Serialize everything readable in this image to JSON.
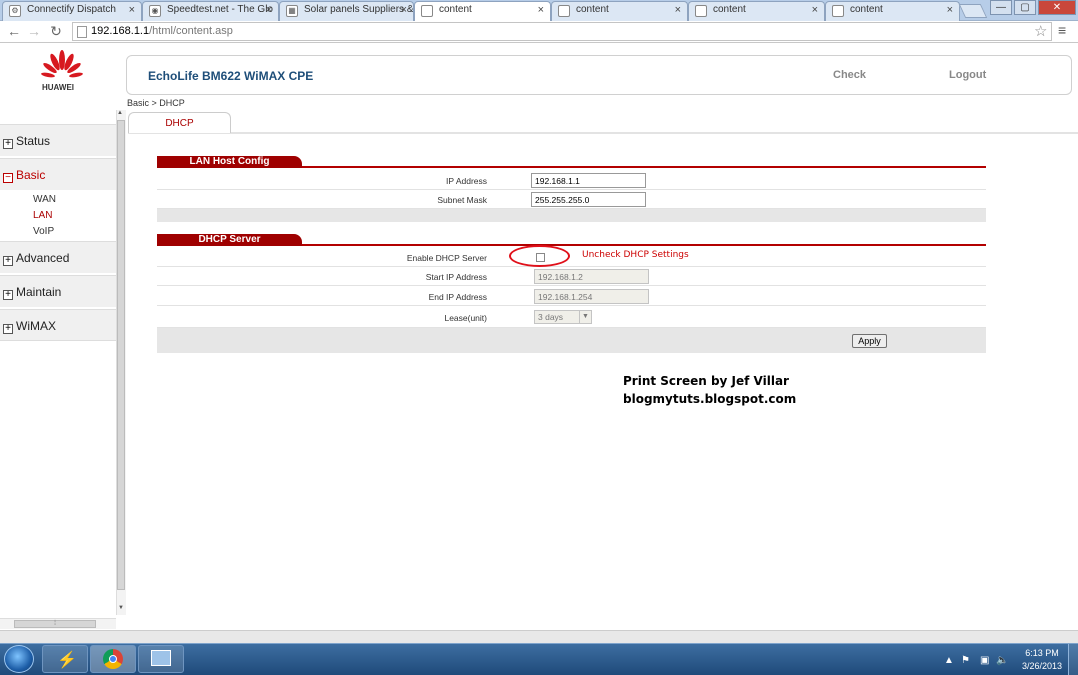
{
  "browser": {
    "tabs": [
      {
        "label": "Connectify Dispatch",
        "icon": "connectify-icon"
      },
      {
        "label": "Speedtest.net - The Glo",
        "icon": "speedtest-icon"
      },
      {
        "label": "Solar panels Suppliers &",
        "icon": "solar-icon"
      },
      {
        "label": "content",
        "icon": "page-icon"
      },
      {
        "label": "content",
        "icon": "page-icon"
      },
      {
        "label": "content",
        "icon": "page-icon"
      },
      {
        "label": "content",
        "icon": "page-icon"
      }
    ],
    "active_tab": 3,
    "close_glyph": "×",
    "url_host": "192.168.1.1",
    "url_path": "/html/content.asp",
    "window_buttons": [
      "—",
      "▢",
      "✕"
    ]
  },
  "header": {
    "brand": "HUAWEI",
    "product": "EchoLife BM622 WiMAX CPE",
    "check": "Check",
    "logout": "Logout"
  },
  "sidebar": {
    "status": "Status",
    "basic": "Basic",
    "wan": "WAN",
    "lan": "LAN",
    "voip": "VoIP",
    "advanced": "Advanced",
    "maintain": "Maintain",
    "wimax": "WiMAX",
    "plus": "+",
    "minus": "−"
  },
  "content": {
    "breadcrumb": "Basic > DHCP",
    "subtab": "DHCP",
    "lan_section": "LAN Host Config",
    "ip_label": "IP Address",
    "ip_value": "192.168.1.1",
    "mask_label": "Subnet Mask",
    "mask_value": "255.255.255.0",
    "dhcp_section": "DHCP Server",
    "enable_label": "Enable DHCP Server",
    "start_label": "Start IP Address",
    "start_value": "192.168.1.2",
    "end_label": "End IP Address",
    "end_value": "192.168.1.254",
    "lease_label": "Lease(unit)",
    "lease_value": "3 days",
    "apply": "Apply",
    "annotation": "Uncheck DHCP Settings",
    "credit_line1": "Print Screen by Jef Villar",
    "credit_line2": "blogmytuts.blogspot.com"
  },
  "taskbar": {
    "time": "6:13 PM",
    "date": "3/26/2013"
  },
  "colors": {
    "accent_red": "#9f0000",
    "link_blue": "#1e4e79",
    "taskbar": "#1f4a7a"
  }
}
